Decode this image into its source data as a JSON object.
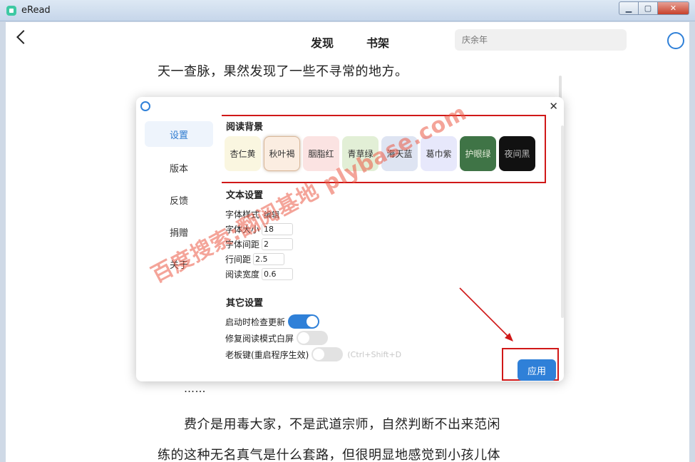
{
  "window": {
    "title": "eRead",
    "min": "▁",
    "max": "▢",
    "close": "✕"
  },
  "header": {
    "nav_discover": "发现",
    "nav_shelf": "书架",
    "search_placeholder": "庆余年"
  },
  "reading": {
    "lines": [
      "天一查脉，果然发现了一些不寻常的地方。",
      "……",
      "费介是用毒大家，不是武道宗师，自然判断不出来范闲",
      "练的这种无名真气是什么套路，但很明显地感觉到小孩儿体"
    ]
  },
  "settings": {
    "side_nav": [
      {
        "label": "设置"
      },
      {
        "label": "版本"
      },
      {
        "label": "反馈"
      },
      {
        "label": "捐赠"
      },
      {
        "label": "关于"
      }
    ],
    "reading_bg_title": "阅读背景",
    "backgrounds": [
      {
        "label": "杏仁黄",
        "color": "#faf6e0"
      },
      {
        "label": "秋叶褐",
        "color": "#fbede1"
      },
      {
        "label": "胭脂红",
        "color": "#fbe3e2"
      },
      {
        "label": "青草绿",
        "color": "#e2efd6"
      },
      {
        "label": "海天蓝",
        "color": "#dee4f2"
      },
      {
        "label": "葛巾紫",
        "color": "#e7e8fb"
      },
      {
        "label": "护眼绿",
        "color": "#3f7446"
      },
      {
        "label": "夜间黑",
        "color": "#111111"
      }
    ],
    "text_settings_title": "文本设置",
    "font_style_label": "字体样式",
    "font_style_edit": "编辑",
    "font_size_label": "字体大小",
    "font_size_value": "18",
    "font_spacing_label": "字体间距",
    "font_spacing_value": "2",
    "line_spacing_label": "行间距",
    "line_spacing_value": "2.5",
    "read_width_label": "阅读宽度",
    "read_width_value": "0.6",
    "other_settings_title": "其它设置",
    "check_update_label": "启动时检查更新",
    "fix_whitescreen_label": "修复阅读模式白屏",
    "boss_key_label": "老板键(重启程序生效)",
    "boss_key_hint": "(Ctrl+Shift+D",
    "apply_label": "应用"
  },
  "watermark": "百度搜索:翻阅基地 plybase.com"
}
